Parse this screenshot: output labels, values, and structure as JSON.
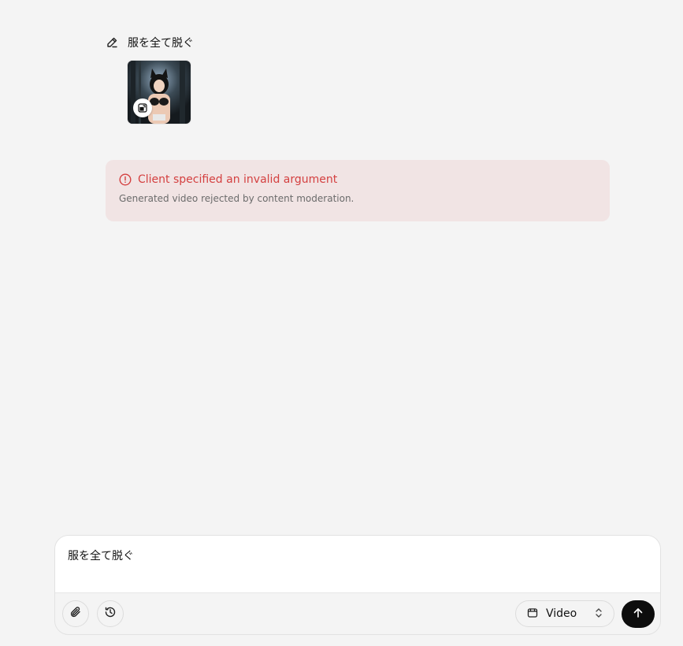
{
  "prompt": {
    "text": "服を全て脱ぐ",
    "icon": "pencil-icon"
  },
  "thumbnail": {
    "badge_icon": "image-to-video-icon"
  },
  "error": {
    "title": "Client specified an invalid argument",
    "detail": "Generated video rejected by content moderation.",
    "icon": "alert-circle-icon",
    "color": "#d44040",
    "background": "#f1e4e4"
  },
  "composer": {
    "input_value": "服を全て脱ぐ",
    "attach_icon": "paperclip-icon",
    "history_icon": "history-icon",
    "mode": {
      "label": "Video",
      "icon": "video-icon",
      "chevron_icon": "chevron-up-down-icon"
    },
    "send_icon": "arrow-up-icon"
  }
}
